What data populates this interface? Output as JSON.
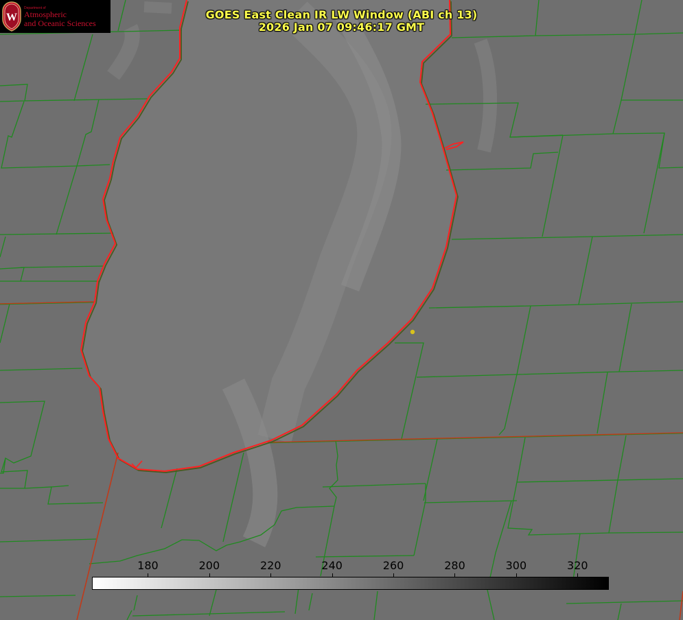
{
  "title": {
    "line1": "GOES East Clean IR LW Window (ABI ch 13)",
    "line2": "2026 Jan 07 09:46:17 GMT"
  },
  "logo": {
    "dept": "Department of",
    "line1": "Atmospheric",
    "line2": "and Oceanic Sciences",
    "seal_letter": "W"
  },
  "colors": {
    "background": "#6f6f6f",
    "lake": "#7a7a7a",
    "county_lines": "#1f8a1f",
    "state_lines": "#c03a1a",
    "shoreline": "#ff2020",
    "title_text": "#ffff4d",
    "marker": "#d9c21c"
  },
  "colorbar": {
    "unit_range": [
      162,
      330
    ],
    "ticks": [
      {
        "value": 180,
        "label": "180"
      },
      {
        "value": 200,
        "label": "200"
      },
      {
        "value": 220,
        "label": "220"
      },
      {
        "value": 240,
        "label": "240"
      },
      {
        "value": 260,
        "label": "260"
      },
      {
        "value": 280,
        "label": "280"
      },
      {
        "value": 300,
        "label": "300"
      },
      {
        "value": 320,
        "label": "320"
      }
    ]
  },
  "map_elements": {
    "lake": "lake-michigan-southern",
    "marker": "site-marker"
  }
}
